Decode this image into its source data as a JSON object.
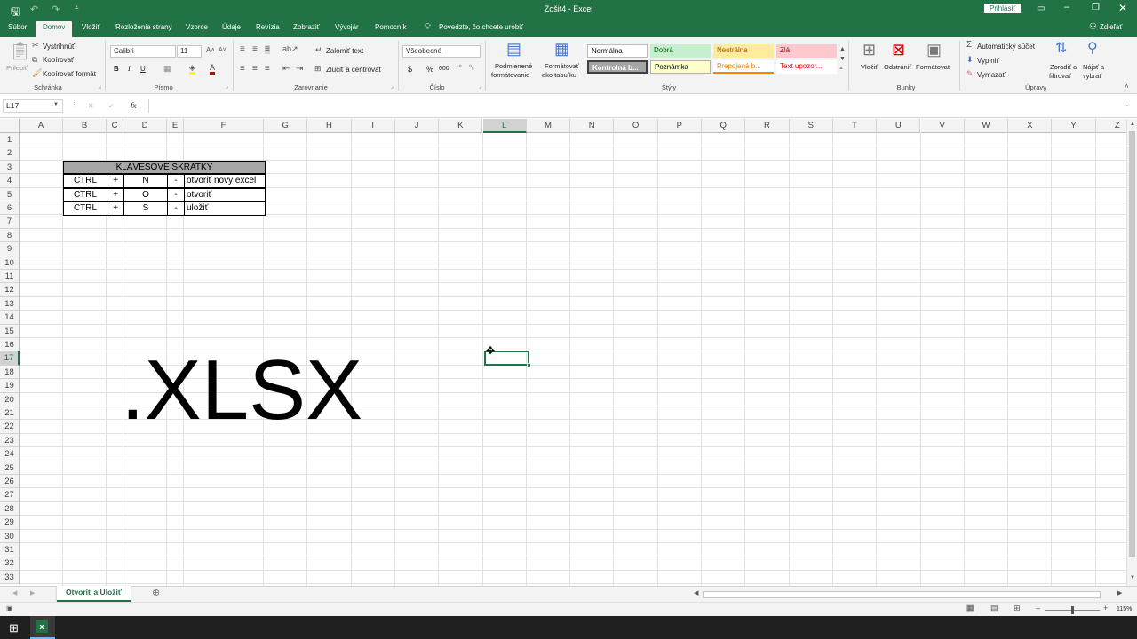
{
  "titlebar": {
    "title": "Zošit4  -  Excel",
    "signin_label": "Prihlásiť",
    "quick_access": [
      "save-icon",
      "undo-icon",
      "redo-icon",
      "customize-icon"
    ],
    "window_controls": [
      "ribbon-display-icon",
      "minimize-icon",
      "restore-icon",
      "close-icon"
    ]
  },
  "tabs": {
    "items": [
      "Súbor",
      "Domov",
      "Vložiť",
      "Rozloženie strany",
      "Vzorce",
      "Údaje",
      "Revízia",
      "Zobraziť",
      "Vývojár",
      "Pomocník"
    ],
    "active": "Domov",
    "tell_me": "Povedzte, čo chcete urobiť",
    "share": "Zdieľať"
  },
  "ribbon": {
    "clipboard": {
      "paste": "Prilepiť",
      "cut": "Vystrihnúť",
      "copy": "Kopírovať",
      "format_painter": "Kopírovať formát",
      "label": "Schránka"
    },
    "font": {
      "name": "Calibri",
      "size": "11",
      "bold": "B",
      "italic": "I",
      "underline": "U",
      "label": "Písmo"
    },
    "alignment": {
      "wrap": "Zalomiť text",
      "merge": "Zlúčiť a centrovať",
      "label": "Zarovnanie"
    },
    "number": {
      "format": "Všeobecné",
      "currency": "$",
      "percent": "%",
      "thousands": "000",
      "label": "Číslo"
    },
    "styles": {
      "conditional": [
        "Podmienené",
        "formátovanie"
      ],
      "as_table": [
        "Formátovať",
        "ako tabuľku"
      ],
      "cells": [
        {
          "label": "Normálna",
          "bg": "#ffffff",
          "color": "#000000"
        },
        {
          "label": "Dobrá",
          "bg": "#c6efce",
          "color": "#006100"
        },
        {
          "label": "Neutrálna",
          "bg": "#ffeb9c",
          "color": "#9c5700"
        },
        {
          "label": "Zlá",
          "bg": "#ffc7ce",
          "color": "#9c0006"
        },
        {
          "label": "Kontrolná b...",
          "bg": "#a5a5a5",
          "color": "#ffffff"
        },
        {
          "label": "Poznámka",
          "bg": "#ffffcc",
          "color": "#000000"
        },
        {
          "label": "Prepojená b...",
          "bg": "#ffffff",
          "color": "#fa7d00"
        },
        {
          "label": "Text upozor...",
          "bg": "#ffffff",
          "color": "#ff0000"
        }
      ],
      "label": "Štýly"
    },
    "cells_group": {
      "insert": "Vložiť",
      "delete": "Odstrániť",
      "format": "Formátovať",
      "label": "Bunky"
    },
    "editing": {
      "autosum": "Automatický súčet",
      "fill": "Vyplniť",
      "clear": "Vymazať",
      "sort": [
        "Zoradiť a",
        "filtrovať"
      ],
      "find": [
        "Nájsť a",
        "vybrať"
      ],
      "label": "Úpravy"
    }
  },
  "formula_bar": {
    "name_box": "L17",
    "cancel": "✕",
    "enter": "✓",
    "fx": "fx",
    "content": ""
  },
  "sheet": {
    "columns": [
      "A",
      "B",
      "C",
      "D",
      "E",
      "F",
      "G",
      "H",
      "I",
      "J",
      "K",
      "L",
      "M",
      "N",
      "O",
      "P",
      "Q",
      "R",
      "S",
      "T",
      "U",
      "V",
      "W",
      "X",
      "Y",
      "Z"
    ],
    "rows": [
      "1",
      "2",
      "3",
      "4",
      "5",
      "6",
      "7",
      "8",
      "9",
      "10",
      "11",
      "12",
      "13",
      "14",
      "15",
      "16",
      "17",
      "18",
      "19",
      "20",
      "21",
      "22",
      "23",
      "24",
      "25",
      "26",
      "27",
      "28",
      "29",
      "30",
      "31",
      "32",
      "33"
    ],
    "active_cell": "L17",
    "table": {
      "header": "KLÁVESOVÉ SKRATKY",
      "rows": [
        [
          "CTRL",
          "+",
          "N",
          "-",
          "otvoriť novy excel"
        ],
        [
          "CTRL",
          "+",
          "O",
          "-",
          "otvoriť"
        ],
        [
          "CTRL",
          "+",
          "S",
          "-",
          "uložiť"
        ]
      ]
    },
    "big_text": ".XLSX"
  },
  "sheet_tabs": {
    "active": "Otvoriť a Uložiť"
  },
  "status": {
    "zoom": "115%"
  }
}
